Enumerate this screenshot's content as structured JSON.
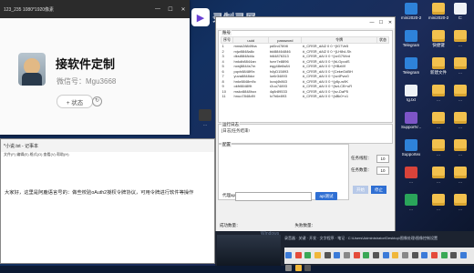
{
  "recorder": {
    "label": "录制录屏"
  },
  "viewer": {
    "title": "123_235   1080*1920像素",
    "card_title": "接软件定制",
    "wechat": "微信号：Mgu3668",
    "status_button": "+ 状态"
  },
  "app": {
    "title": "",
    "group_label": "账号",
    "columns": [
      "序号",
      "uuid",
      "password",
      "令牌",
      "状态"
    ],
    "rows": [
      [
        "1",
        "mnsk28849ba",
        "pd5n47898",
        "#_CRSR_dAl2 0 0 ^{IG7Ve5",
        ""
      ],
      [
        "2",
        "rxjw8848a8c",
        "bkl88464846",
        "#_CRSR_dAl2 0 0 ^{LH8vLSh",
        ""
      ],
      [
        "3",
        "dksi8848d4u",
        "hi64876313",
        "#_CRSR_dAl 0 0 ^{vzG7Wvd",
        ""
      ],
      [
        "4",
        "hnkdb8844an",
        "hzvr7e8896",
        "#_CRSR_dAl 0 0 ^{bLGpodS",
        ""
      ],
      [
        "5",
        "rowj8844s7m",
        "eqg48e6s84",
        "#_CRSR_dAl 0 0 ^{HBzMf",
        ""
      ],
      [
        "6",
        "pqvh8848f9x",
        "h4yD15893",
        "#_CRSR_dAl 0 0 ^{CekeGdBH",
        ""
      ],
      [
        "7",
        "yuva8848dcr",
        "lur6r34893",
        "#_CRSR_dAl 0 0 ^{xz4Pwv0",
        ""
      ],
      [
        "8",
        "hnkr8848m9c",
        "lcvuj4h863",
        "#_CRSR_dAl 0 0 ^{y8y-w9K",
        ""
      ],
      [
        "9",
        "okfr8848l9t",
        "r2uu74893",
        "#_CRSR_dAl 0 0 ^{bzLCB+uR",
        ""
      ],
      [
        "10",
        "mskv8848hox",
        "4q8r89533",
        "#_CRSR_dAl 0 0 ^{sv-DaP5",
        ""
      ],
      [
        "11",
        "hnuo7848d9l",
        "lv7h6e893",
        "#_CRSR_dAl 0 0 ^{sBk0+c1",
        ""
      ]
    ],
    "log_label": "运行日志",
    "log_text": "[日志]任务结束!",
    "setting_label": "配置",
    "proxy_label": "代理api：",
    "apply_button": "api测试",
    "thread_label": "任务线程：",
    "thread_value": "10",
    "count_label": "任务数量：",
    "count_value": "10",
    "start_button": "开始",
    "stop_button": "停止",
    "status_left": "成功数量：",
    "status_right": "失败数量："
  },
  "notepad": {
    "title": "*小说.txt - 记事本",
    "menu": "文件(F)  编辑(E)  格式(O)  查看(V)  帮助(H)",
    "text": "大家好，这里是阿鹿语言号的：做些校验oAuth2授权令牌协议，可用令牌进行软件等操作"
  },
  "bottom_window": {
    "title": "录音器 · 关键 · 开发 · 文字程序 · 笔记 · C:\\Users\\Administrator\\Desktop\\图像处理\\图像控制设置",
    "watermark": "Windows"
  },
  "desktop_icons": [
    {
      "label": "mini2020-2...",
      "color": "#2e82d9"
    },
    {
      "label": "mini2020-2...",
      "color": "#f2c14e"
    },
    {
      "label": "Telegram",
      "color": "#2e82d9"
    },
    {
      "label": "快捷键",
      "color": "#f2c14e"
    },
    {
      "label": "Telegram",
      "color": "#2e82d9"
    },
    {
      "label": "新建文件",
      "color": "#f2c14e"
    },
    {
      "label": "SupportV...",
      "color": "#7d55c7"
    },
    {
      "label": "Supportex",
      "color": "#2e82d9"
    }
  ]
}
